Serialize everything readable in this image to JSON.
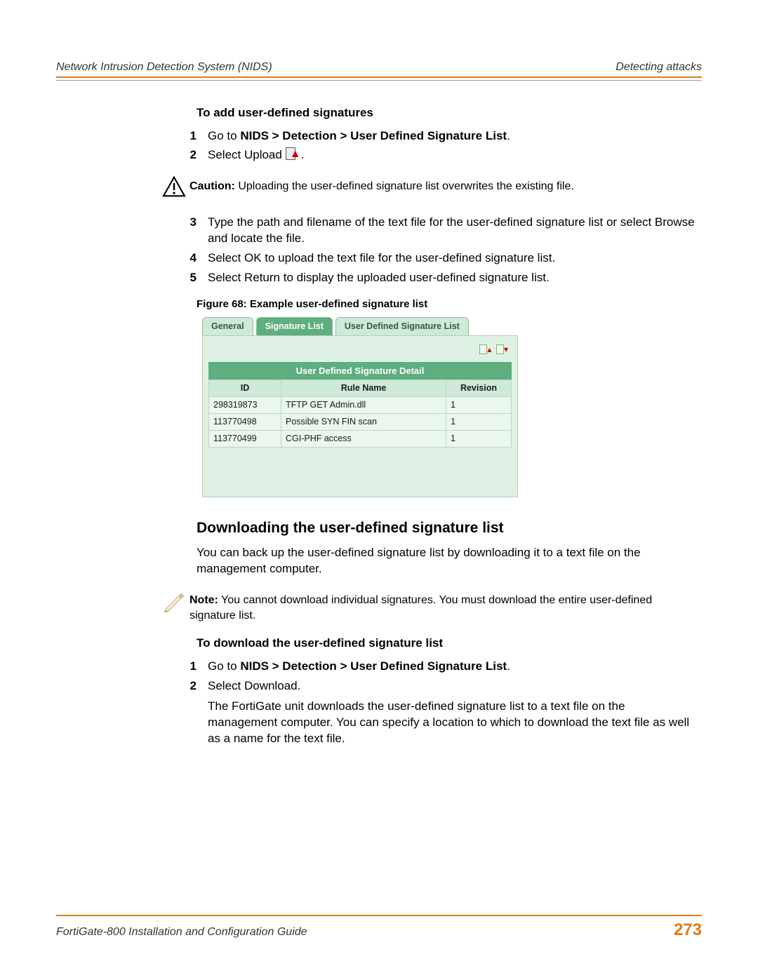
{
  "header": {
    "left": "Network Intrusion Detection System (NIDS)",
    "right": "Detecting attacks"
  },
  "sec1": {
    "title": "To add user-defined signatures",
    "steps": {
      "s1_pre": "Go to ",
      "s1_bold": "NIDS > Detection > User Defined Signature List",
      "s1_post": ".",
      "s2_pre": "Select Upload ",
      "s2_post": "."
    }
  },
  "caution": {
    "label": "Caution:",
    "text": " Uploading the user-defined signature list overwrites the existing file."
  },
  "sec1b": {
    "s3": "Type the path and filename of the text file for the user-defined signature list or select Browse and locate the file.",
    "s4": "Select OK to upload the text file for the user-defined signature list.",
    "s5": "Select Return to display the uploaded user-defined signature list."
  },
  "figure": {
    "caption": "Figure 68: Example user-defined signature list",
    "tabs": {
      "general": "General",
      "siglist": "Signature List",
      "udsl": "User Defined Signature List"
    },
    "table_title": "User Defined Signature Detail",
    "cols": {
      "id": "ID",
      "rule": "Rule Name",
      "rev": "Revision"
    },
    "rows": [
      {
        "id": "298319873",
        "rule": "TFTP GET Admin.dll",
        "rev": "1"
      },
      {
        "id": "113770498",
        "rule": "Possible SYN FIN scan",
        "rev": "1"
      },
      {
        "id": "113770499",
        "rule": "CGI-PHF access",
        "rev": "1"
      }
    ]
  },
  "sec2": {
    "heading": "Downloading the user-defined signature list",
    "para": "You can back up the user-defined signature list by downloading it to a text file on the management computer."
  },
  "note": {
    "label": "Note:",
    "text": " You cannot download individual signatures. You must download the entire user-defined signature list."
  },
  "sec3": {
    "title": "To download the user-defined signature list",
    "s1_pre": "Go to ",
    "s1_bold": "NIDS > Detection > User Defined Signature List",
    "s1_post": ".",
    "s2": "Select Download.",
    "s2_para": "The FortiGate unit downloads the user-defined signature list to a text file on the management computer. You can specify a location to which to download the text file as well as a name for the text file."
  },
  "footer": {
    "left": "FortiGate-800 Installation and Configuration Guide",
    "page": "273"
  },
  "nums": {
    "n1": "1",
    "n2": "2",
    "n3": "3",
    "n4": "4",
    "n5": "5"
  }
}
